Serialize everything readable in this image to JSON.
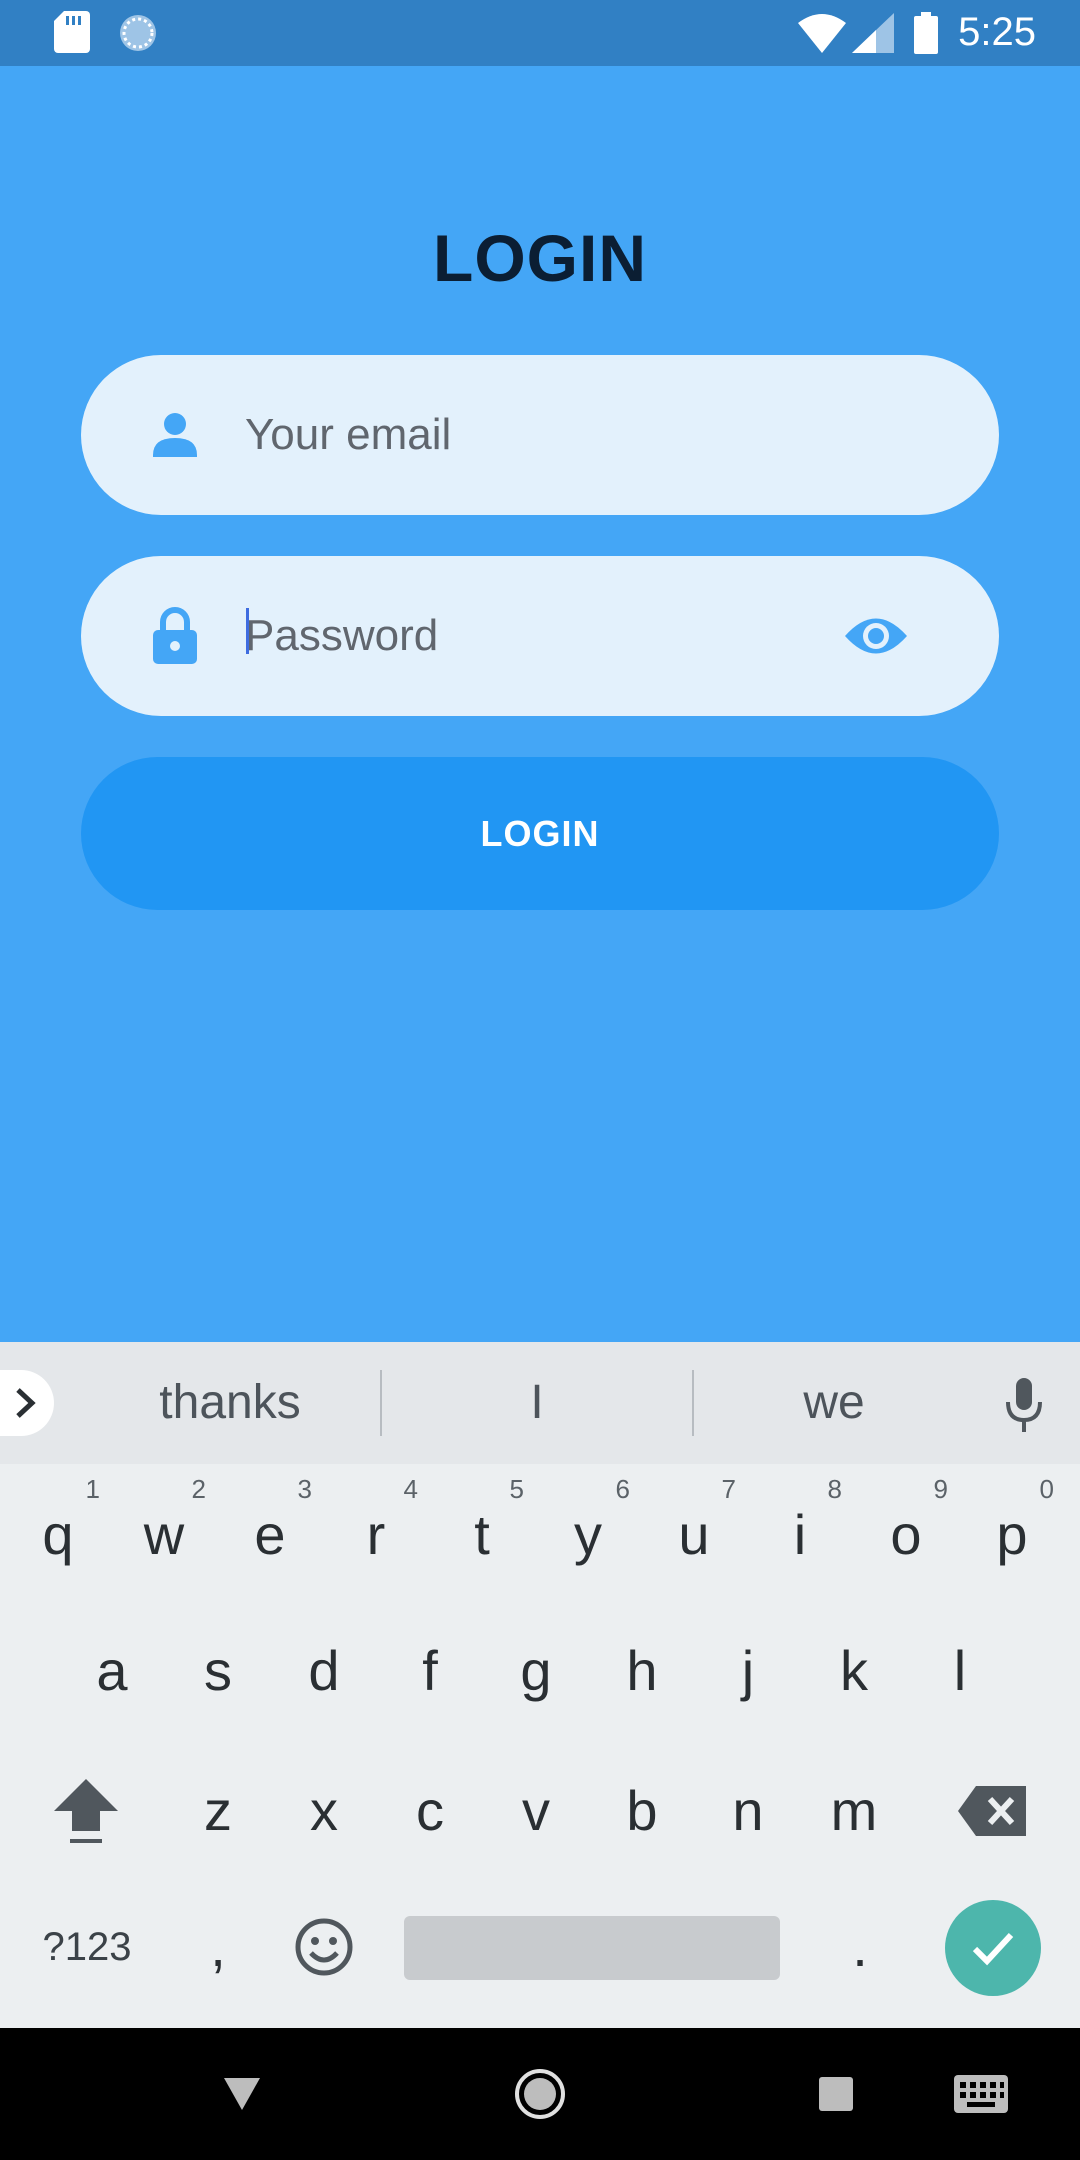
{
  "status_bar": {
    "time": "5:25",
    "icons": [
      "sd-card-icon",
      "sync-icon",
      "wifi-icon",
      "cell-signal-icon",
      "battery-icon"
    ]
  },
  "login": {
    "title": "LOGIN",
    "email_placeholder": "Your email",
    "password_placeholder": "Password",
    "submit_label": "LOGIN"
  },
  "colors": {
    "background": "#44A6F6",
    "status_bar": "#3180C4",
    "field_bg": "#E3F1FC",
    "accent": "#2196F3",
    "title": "#0B1E33",
    "enter_key": "#4DB6AC"
  },
  "keyboard": {
    "suggestions": [
      "thanks",
      "I",
      "we"
    ],
    "row1": [
      {
        "key": "q",
        "hint": "1"
      },
      {
        "key": "w",
        "hint": "2"
      },
      {
        "key": "e",
        "hint": "3"
      },
      {
        "key": "r",
        "hint": "4"
      },
      {
        "key": "t",
        "hint": "5"
      },
      {
        "key": "y",
        "hint": "6"
      },
      {
        "key": "u",
        "hint": "7"
      },
      {
        "key": "i",
        "hint": "8"
      },
      {
        "key": "o",
        "hint": "9"
      },
      {
        "key": "p",
        "hint": "0"
      }
    ],
    "row2": [
      "a",
      "s",
      "d",
      "f",
      "g",
      "h",
      "j",
      "k",
      "l"
    ],
    "row3": [
      "z",
      "x",
      "c",
      "v",
      "b",
      "n",
      "m"
    ],
    "symbols_label": "?123",
    "comma": ",",
    "period": "."
  },
  "nav_bar": {
    "icons": [
      "back-icon",
      "home-icon",
      "recents-icon",
      "keyboard-switch-icon"
    ]
  }
}
